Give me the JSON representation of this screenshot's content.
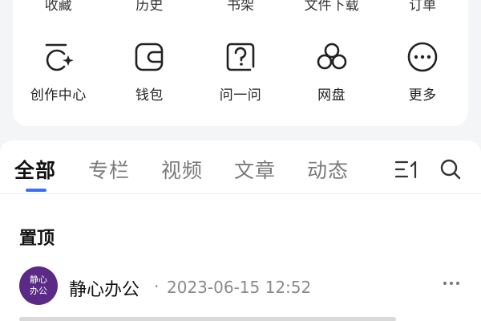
{
  "top_row_cutoff": [
    "收藏",
    "历史",
    "书架",
    "文件下载",
    "订单"
  ],
  "functions": [
    {
      "label": "创作中心",
      "icon": "creation-center-icon"
    },
    {
      "label": "钱包",
      "icon": "wallet-icon"
    },
    {
      "label": "问一问",
      "icon": "question-icon"
    },
    {
      "label": "网盘",
      "icon": "cloud-drive-icon"
    },
    {
      "label": "更多",
      "icon": "more-icon"
    }
  ],
  "tabs": [
    {
      "label": "全部",
      "active": true
    },
    {
      "label": "专栏",
      "active": false
    },
    {
      "label": "视频",
      "active": false
    },
    {
      "label": "文章",
      "active": false
    },
    {
      "label": "动态",
      "active": false
    }
  ],
  "pinned": {
    "title": "置顶"
  },
  "post": {
    "avatar_text": "静心办公",
    "author": "静心办公",
    "separator": "·",
    "time": "2023-06-15 12:52"
  },
  "colors": {
    "accent": "#3a6ff7",
    "avatar_bg": "#5b2a86"
  }
}
